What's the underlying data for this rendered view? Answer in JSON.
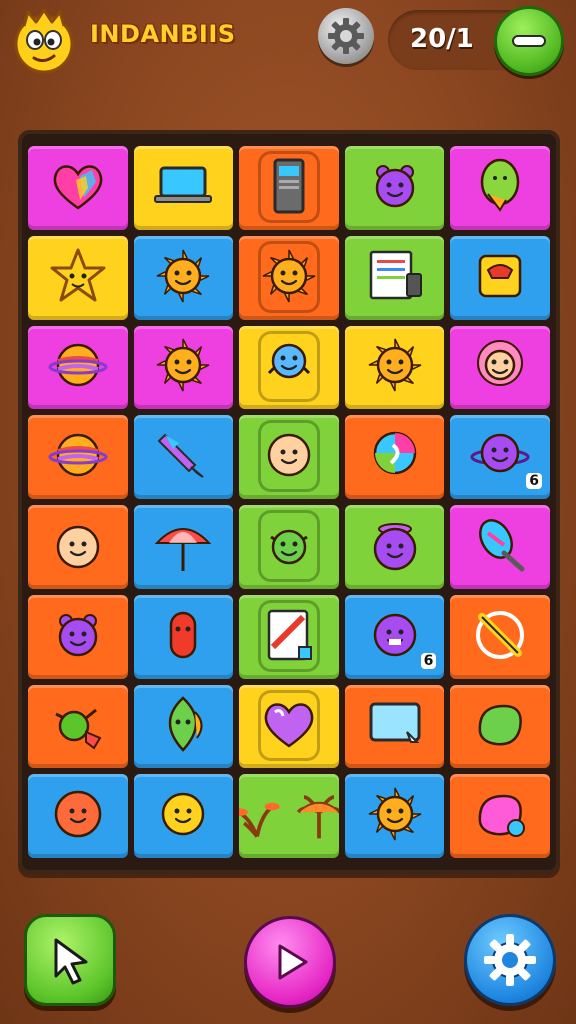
{
  "header": {
    "title": "INDANBIIS",
    "score": "20/1",
    "settings_icon": "gear-icon",
    "minus_icon": "minus-icon",
    "mascot_icon": "smiley-mascot-icon"
  },
  "board": {
    "columns": 5,
    "rows": 8,
    "tiles": [
      {
        "icon": "heart-icon",
        "bg": "#ee3fe0",
        "badge": ""
      },
      {
        "icon": "laptop-icon",
        "bg": "#ffd21e",
        "badge": ""
      },
      {
        "icon": "server-tower-icon",
        "bg": "#ff6a1c",
        "badge": "",
        "inner": true
      },
      {
        "icon": "purple-creature-icon",
        "bg": "#7fd23a",
        "badge": ""
      },
      {
        "icon": "green-balloon-icon",
        "bg": "#ee3fe0",
        "badge": ""
      },
      {
        "icon": "star-icon",
        "bg": "#ffd21e",
        "badge": ""
      },
      {
        "icon": "sun-creature-icon",
        "bg": "#2fa0ee",
        "badge": ""
      },
      {
        "icon": "sun-icon",
        "bg": "#ff6a1c",
        "badge": "",
        "inner": true
      },
      {
        "icon": "document-icon",
        "bg": "#7fd23a",
        "badge": ""
      },
      {
        "icon": "red-phone-icon",
        "bg": "#2fa0ee",
        "badge": ""
      },
      {
        "icon": "planet-icon",
        "bg": "#ee3fe0",
        "badge": ""
      },
      {
        "icon": "orange-creature-icon",
        "bg": "#ee3fe0",
        "badge": ""
      },
      {
        "icon": "blue-creature-icon",
        "bg": "#ffd21e",
        "badge": "",
        "inner": true
      },
      {
        "icon": "orange-creature-icon",
        "bg": "#ffd21e",
        "badge": ""
      },
      {
        "icon": "girl-face-icon",
        "bg": "#ee3fe0",
        "badge": ""
      },
      {
        "icon": "striped-planet-icon",
        "bg": "#ff6a1c",
        "badge": ""
      },
      {
        "icon": "rocket-icon",
        "bg": "#2fa0ee",
        "badge": ""
      },
      {
        "icon": "baby-face-icon",
        "bg": "#7fd23a",
        "badge": "",
        "inner": true
      },
      {
        "icon": "swirl-icon",
        "bg": "#ff6a1c",
        "badge": ""
      },
      {
        "icon": "purple-planet-icon",
        "bg": "#2fa0ee",
        "badge": "6"
      },
      {
        "icon": "boy-face-icon",
        "bg": "#ff6a1c",
        "badge": ""
      },
      {
        "icon": "umbrella-icon",
        "bg": "#2fa0ee",
        "badge": ""
      },
      {
        "icon": "green-creature-icon",
        "bg": "#7fd23a",
        "badge": "",
        "inner": true
      },
      {
        "icon": "purple-pot-icon",
        "bg": "#7fd23a",
        "badge": ""
      },
      {
        "icon": "paintbrush-icon",
        "bg": "#ee3fe0",
        "badge": ""
      },
      {
        "icon": "purple-creature-icon",
        "bg": "#ff6a1c",
        "badge": ""
      },
      {
        "icon": "red-creature-icon",
        "bg": "#2fa0ee",
        "badge": ""
      },
      {
        "icon": "card-icon",
        "bg": "#7fd23a",
        "badge": "",
        "inner": true
      },
      {
        "icon": "purple-monster-icon",
        "bg": "#2fa0ee",
        "badge": "6"
      },
      {
        "icon": "pencil-icon",
        "bg": "#ff6a1c",
        "badge": ""
      },
      {
        "icon": "green-bug-icon",
        "bg": "#ff6a1c",
        "badge": ""
      },
      {
        "icon": "leaf-icon",
        "bg": "#2fa0ee",
        "badge": ""
      },
      {
        "icon": "purple-heart-icon",
        "bg": "#ffd21e",
        "badge": "",
        "inner": true
      },
      {
        "icon": "screen-icon",
        "bg": "#ff6a1c",
        "badge": ""
      },
      {
        "icon": "green-blob-icon",
        "bg": "#ff6a1c",
        "badge": ""
      },
      {
        "icon": "orange-ball-icon",
        "bg": "#2fa0ee",
        "badge": ""
      },
      {
        "icon": "yellow-face-icon",
        "bg": "#2fa0ee",
        "badge": ""
      },
      {
        "icon": "plants-icon",
        "bg": "#7fd23a",
        "badge": "",
        "wide": true
      },
      {
        "icon": "orange-creature-icon",
        "bg": "#2fa0ee",
        "badge": ""
      },
      {
        "icon": "pink-blob-icon",
        "bg": "#ff6a1c",
        "badge": ""
      }
    ]
  },
  "controls": {
    "pointer_icon": "pointer-icon",
    "play_icon": "play-icon",
    "settings_icon": "gear-icon"
  }
}
